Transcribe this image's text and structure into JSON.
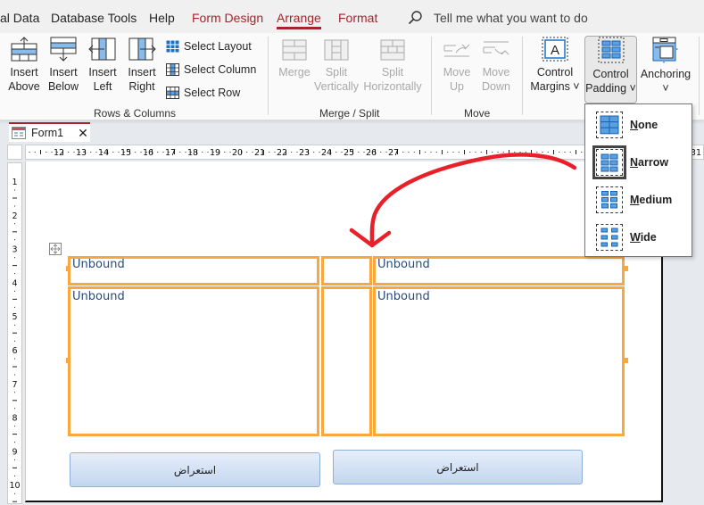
{
  "menu": {
    "tabs": [
      "al Data",
      "Database Tools",
      "Help",
      "Form Design",
      "Arrange",
      "Format"
    ],
    "active_tab": "Arrange",
    "search_placeholder": "Tell me what you want to do"
  },
  "ribbon": {
    "rows_columns": {
      "insert_above": [
        "Insert",
        "Above"
      ],
      "insert_below": [
        "Insert",
        "Below"
      ],
      "insert_left": [
        "Insert",
        "Left"
      ],
      "insert_right": [
        "Insert",
        "Right"
      ],
      "select_layout": "Select Layout",
      "select_column": "Select Column",
      "select_row": "Select Row",
      "label": "Rows & Columns"
    },
    "merge_split": {
      "merge": "Merge",
      "split_vertically": [
        "Split",
        "Vertically"
      ],
      "split_horizontally": [
        "Split",
        "Horizontally"
      ],
      "label": "Merge / Split"
    },
    "move": {
      "move_up": [
        "Move",
        "Up"
      ],
      "move_down": [
        "Move",
        "Down"
      ],
      "label": "Move"
    },
    "position": {
      "control_margins": [
        "Control",
        "Margins ˅"
      ],
      "control_padding": [
        "Control",
        "Padding ˅"
      ],
      "anchoring": [
        "Anchoring",
        "˅"
      ]
    }
  },
  "document": {
    "tab_label": "Form1",
    "ruler_h": [
      "12",
      "13",
      "14",
      "15",
      "16",
      "17",
      "18",
      "19",
      "20",
      "21",
      "22",
      "23",
      "24",
      "25",
      "26",
      "27",
      "31"
    ],
    "ruler_v": [
      "1",
      "2",
      "3",
      "4",
      "5",
      "6",
      "7",
      "8",
      "9",
      "10"
    ],
    "controls": [
      "Unbound",
      "Unbound",
      "Unbound",
      "Unbound"
    ],
    "buttons": [
      "استعراض",
      "استعراض"
    ]
  },
  "padding_dropdown": {
    "items": [
      {
        "key": "N",
        "rest": "one"
      },
      {
        "key": "N",
        "rest": "arrow"
      },
      {
        "key": "M",
        "rest": "edium"
      },
      {
        "key": "W",
        "rest": "ide"
      }
    ],
    "selected": "Narrow"
  },
  "colors": {
    "accent": "#a4262c",
    "control_border": "#f9a73e",
    "annotation_arrow": "#e8202a",
    "icon_blue": "#1a73c8"
  }
}
